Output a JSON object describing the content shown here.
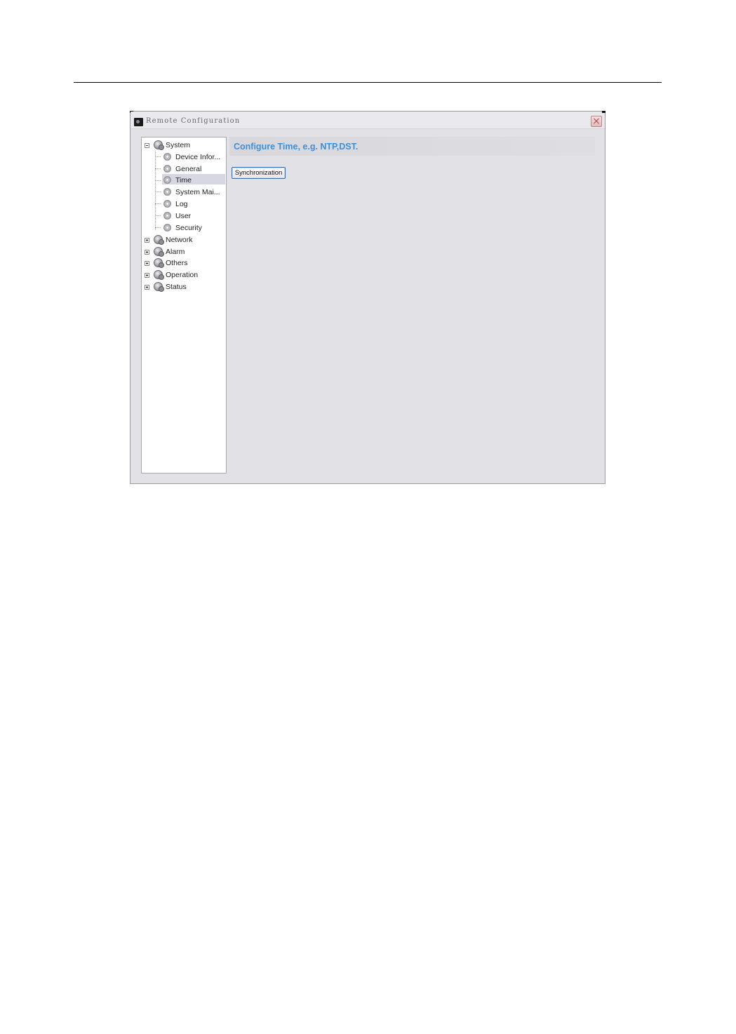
{
  "window": {
    "title": "Remote Configuration",
    "close_glyph": "×"
  },
  "tree": {
    "system": {
      "label": "System",
      "children": [
        "Device Infor...",
        "General",
        "Time",
        "System Mai...",
        "Log",
        "User",
        "Security"
      ]
    },
    "selected_child": "Time",
    "collapsed": [
      "Network",
      "Alarm",
      "Others",
      "Operation",
      "Status"
    ]
  },
  "main": {
    "header": "Configure Time, e.g. NTP,DST.",
    "sync_button_label": "Synchronization"
  },
  "colors": {
    "header_text": "#3d8fd6",
    "window_bg": "#e1e1e6"
  }
}
